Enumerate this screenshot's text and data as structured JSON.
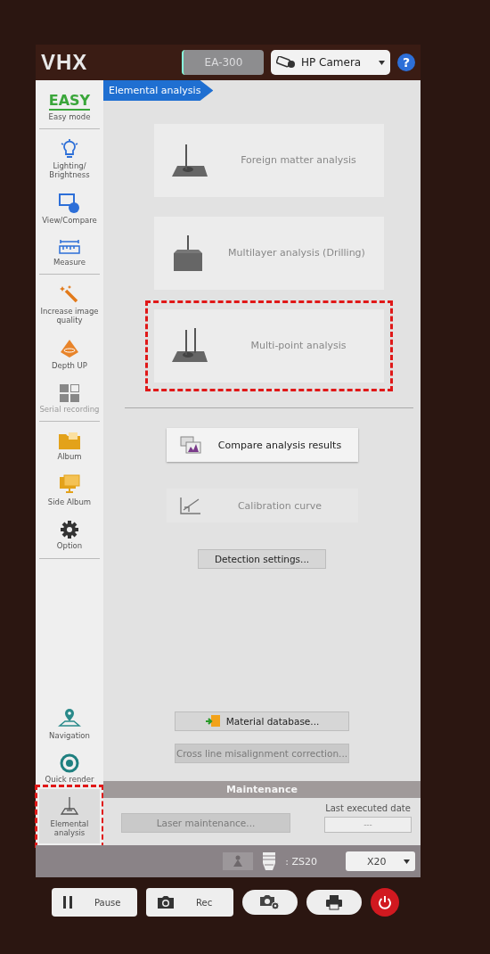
{
  "top_bar": {
    "logo": "VHX",
    "unit_field": {
      "value": "EA-300",
      "disabled": true
    },
    "camera_select": {
      "value": "HP Camera"
    },
    "help": "?"
  },
  "sidebar": {
    "groups": [
      {
        "items": [
          {
            "kind": "logo",
            "logo": "EASY",
            "label": "Easy mode",
            "selected": false,
            "disabled": false,
            "highlighted": false
          }
        ]
      },
      {
        "items": [
          {
            "kind": "icon",
            "label": "Lighting/ Brightness",
            "selected": false,
            "disabled": false,
            "highlighted": false
          },
          {
            "kind": "icon",
            "label": "View/Compare",
            "selected": false,
            "disabled": false,
            "highlighted": false
          },
          {
            "kind": "icon",
            "label": "Measure",
            "selected": false,
            "disabled": false,
            "highlighted": false
          }
        ]
      },
      {
        "items": [
          {
            "kind": "icon",
            "label": "Increase image quality",
            "selected": false,
            "disabled": false,
            "highlighted": false
          },
          {
            "kind": "icon",
            "label": "Depth UP",
            "selected": false,
            "disabled": false,
            "highlighted": false
          },
          {
            "kind": "icon",
            "label": "Serial recording",
            "selected": false,
            "disabled": true,
            "highlighted": false
          }
        ]
      },
      {
        "items": [
          {
            "kind": "icon",
            "label": "Album",
            "selected": false,
            "disabled": false,
            "highlighted": false
          },
          {
            "kind": "icon",
            "label": "Side Album",
            "selected": false,
            "disabled": false,
            "highlighted": false
          },
          {
            "kind": "icon",
            "label": "Option",
            "selected": false,
            "disabled": false,
            "highlighted": false
          }
        ]
      },
      {
        "items": [
          {
            "kind": "icon",
            "label": "Navigation",
            "selected": false,
            "disabled": false,
            "highlighted": false
          },
          {
            "kind": "icon",
            "label": "Quick render",
            "selected": false,
            "disabled": false,
            "highlighted": false
          },
          {
            "kind": "icon",
            "label": "Elemental analysis",
            "selected": true,
            "disabled": false,
            "highlighted": true
          }
        ]
      }
    ]
  },
  "breadcrumb": "Elemental analysis",
  "modes": [
    {
      "label": "Foreign matter analysis",
      "highlighted": false
    },
    {
      "label": "Multilayer analysis (Drilling)",
      "highlighted": false
    },
    {
      "label": "Multi-point analysis",
      "highlighted": true
    }
  ],
  "actions": [
    {
      "label": "Compare analysis results",
      "disabled": false
    },
    {
      "label": "Calibration curve",
      "disabled": true
    }
  ],
  "detection_button": "Detection settings...",
  "material_button": {
    "label": "Material database...",
    "disabled": false
  },
  "cross_line_button": {
    "label": "Cross line misalignment correction...",
    "disabled": true
  },
  "maintenance": {
    "title": "Maintenance",
    "laser_button": {
      "label": "Laser maintenance...",
      "disabled": true
    },
    "date_label": "Last executed date",
    "date_value": "---"
  },
  "status_bar": {
    "lens": ": ZS20",
    "zoom_select": "X20"
  },
  "controls": [
    {
      "kind": "pause",
      "label": "Pause"
    },
    {
      "kind": "rec",
      "label": "Rec"
    },
    {
      "kind": "camera_settings"
    },
    {
      "kind": "print"
    },
    {
      "kind": "power"
    }
  ]
}
